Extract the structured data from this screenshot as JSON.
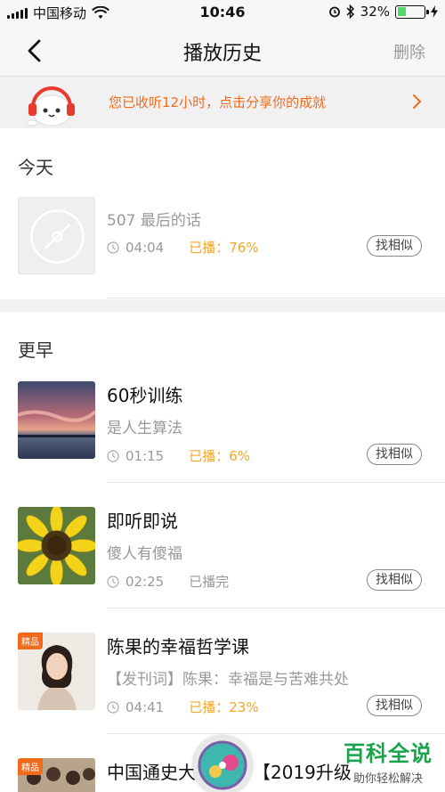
{
  "status_bar": {
    "carrier": "中国移动",
    "time": "10:46",
    "battery_percent": "32%",
    "battery_level": 0.32
  },
  "nav": {
    "title": "播放历史",
    "action": "删除"
  },
  "banner": {
    "text": "您已收听12小时，点击分享你的成就"
  },
  "sections": {
    "today": "今天",
    "earlier": "更早"
  },
  "items": [
    {
      "title": "507 最后的话",
      "subtitle": "",
      "duration": "04:04",
      "played": "已播：76%",
      "played_highlight": true,
      "find_similar": "找相似",
      "thumb": "disc-placeholder"
    },
    {
      "title": "60秒训练",
      "subtitle": "是人生算法",
      "duration": "01:15",
      "played": "已播：6%",
      "played_highlight": true,
      "find_similar": "找相似",
      "thumb": "sunset-photo"
    },
    {
      "title": "即听即说",
      "subtitle": "傻人有傻福",
      "duration": "02:25",
      "played": "已播完",
      "played_highlight": false,
      "find_similar": "找相似",
      "thumb": "sunflower-photo"
    },
    {
      "title": "陈果的幸福哲学课",
      "subtitle": "【发刊词】陈果：幸福是与苦难共处",
      "duration": "04:41",
      "played": "已播：23%",
      "played_highlight": true,
      "find_similar": "找相似",
      "badge": "精品",
      "thumb": "portrait-photo"
    },
    {
      "title": "中国通史大",
      "title_tail": "【2019升级",
      "badge": "精品",
      "thumb": "group-photo"
    }
  ],
  "watermark": {
    "big": "百科全说",
    "small": "助你轻松解决"
  },
  "colors": {
    "accent_orange": "#f26b1d",
    "played_orange": "#f5a623",
    "watermark_green": "#1aa34a"
  }
}
